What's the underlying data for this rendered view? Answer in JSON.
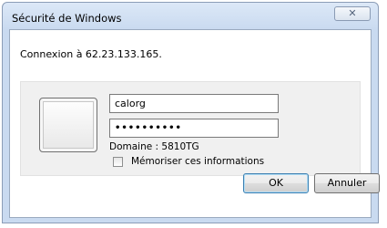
{
  "window": {
    "title": "Sécurité de Windows",
    "close_label": "✕"
  },
  "dialog": {
    "message": "Connexion à 62.23.133.165."
  },
  "credentials": {
    "username_value": "calorg",
    "password_masked": "••••••••••",
    "domain_text": "Domaine : 5810TG",
    "remember_label": "Mémoriser ces informations",
    "remember_checked": false
  },
  "buttons": {
    "ok_label": "OK",
    "cancel_label": "Annuler"
  },
  "colors": {
    "titlebar": "#c9daf0",
    "ok_focus_border": "#3c7fb1"
  }
}
